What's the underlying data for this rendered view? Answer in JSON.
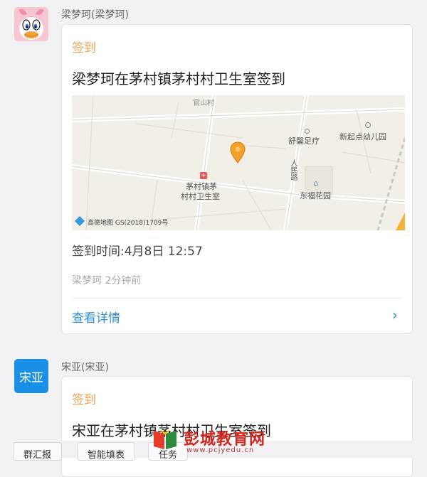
{
  "messages": [
    {
      "sender": "梁梦珂(梁梦珂)",
      "type_label": "签到",
      "title": "梁梦珂在茅村镇茅村村卫生室签到",
      "map": {
        "labels": [
          "官山村",
          "舒馨足疗",
          "新起点幼儿园",
          "茅村镇茅",
          "村村卫生室",
          "人民路",
          "东福花园"
        ],
        "attribution": "高德地图  GS(2018)1709号"
      },
      "time": "签到时间:4月8日 12:57",
      "meta": "梁梦珂  2分钟前",
      "detail_label": "查看详情"
    },
    {
      "sender": "宋亚(宋亚)",
      "avatar_text": "宋亚",
      "type_label": "签到",
      "title": "宋亚在茅村镇茅村村卫生室签到"
    }
  ],
  "bottom_bar": {
    "buttons": [
      "群汇报",
      "智能填表",
      "任务"
    ]
  },
  "watermark": {
    "text": "彭城教育网",
    "url": "www.pcjyedu.cn"
  },
  "colors": {
    "accent_blue": "#2c8fe0",
    "checkin_orange": "#f0a356",
    "avatar_blue": "#1a8fe8"
  },
  "icons": [
    "duck-avatar-icon",
    "location-pin-icon",
    "hospital-icon",
    "building-icon",
    "chevron-right-icon",
    "map-logo-icon"
  ]
}
